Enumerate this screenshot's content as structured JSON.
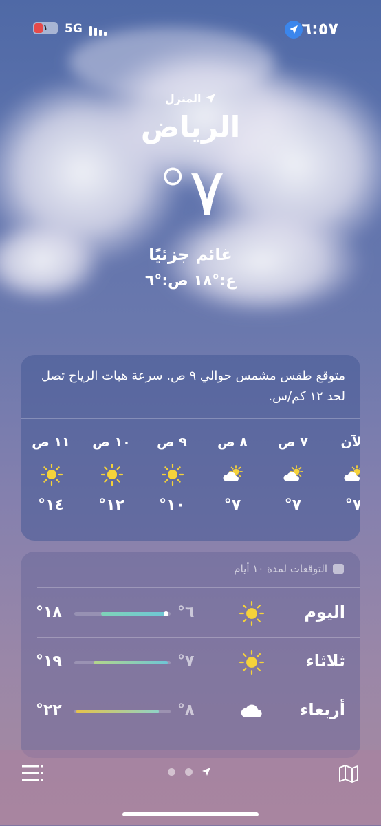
{
  "status": {
    "time": "٦:٥٧",
    "network": "5G",
    "battery": "١"
  },
  "location": {
    "home_label": "المنزل",
    "city": "الرياض",
    "temperature": "°٧",
    "condition": "غائم جزئيًا",
    "high_low": "ع:°١٨  ص:°٦"
  },
  "hourly": {
    "summary": "متوقع طقس مشمس حوالي ٩ ص. سرعة هبات الرياح تصل لحد ١٢ كم/س.",
    "hours": [
      {
        "label": "الآن",
        "icon": "partly-cloudy-icon",
        "temp": "°٧"
      },
      {
        "label": "٧ ص",
        "icon": "partly-cloudy-icon",
        "temp": "°٧"
      },
      {
        "label": "٨ ص",
        "icon": "partly-cloudy-icon",
        "temp": "°٧"
      },
      {
        "label": "٩ ص",
        "icon": "sun-icon",
        "temp": "°١٠"
      },
      {
        "label": "١٠ ص",
        "icon": "sun-icon",
        "temp": "°١٢"
      },
      {
        "label": "١١ ص",
        "icon": "sun-icon",
        "temp": "°١٤"
      }
    ]
  },
  "forecast": {
    "header": "التوقعات لمدة ١٠ أيام",
    "days": [
      {
        "day": "اليوم",
        "icon": "sun-icon",
        "low": "°٦",
        "high": "°١٨",
        "range_start": 0.28,
        "range_end": 0.97,
        "colors": [
          "#7fd3b8",
          "#6ec6d6"
        ]
      },
      {
        "day": "ثلاثاء",
        "icon": "sun-icon",
        "low": "°٧",
        "high": "°١٩",
        "range_start": 0.2,
        "range_end": 0.97,
        "colors": [
          "#b3d68a",
          "#6ec6d6"
        ]
      },
      {
        "day": "أربعاء",
        "icon": "cloud-icon",
        "low": "°٨",
        "high": "°٢٢",
        "range_start": 0.02,
        "range_end": 0.88,
        "colors": [
          "#e6c34a",
          "#8fd3c7"
        ]
      }
    ]
  },
  "toolbar": {
    "list_icon": "list-icon",
    "map_icon": "map-icon"
  }
}
